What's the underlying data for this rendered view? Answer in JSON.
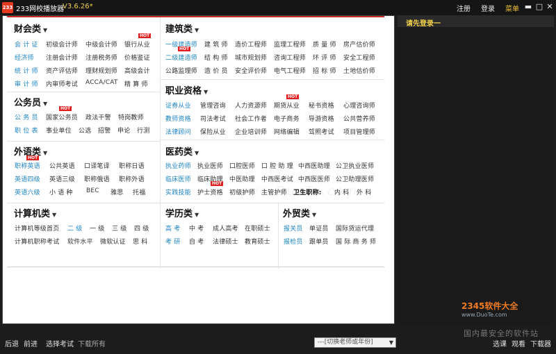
{
  "titlebar": {
    "logo": "233",
    "title": "233网校播放器",
    "version": "V3.6.26*",
    "register": "注册",
    "login": "登录",
    "menu": "菜单",
    "min": "▬",
    "max": "□",
    "close": "✕"
  },
  "sidebar": {
    "login_prompt": "请先登录一"
  },
  "sections": {
    "caikuai": {
      "title": "财会类",
      "rows": [
        [
          "会 计 证",
          "初级会计师",
          "中级会计师",
          "银行从业"
        ],
        [
          "经济师",
          "注册会计师",
          "注册税务师",
          "价格鉴证"
        ],
        [
          "统 计 师",
          "资产评估师",
          "理财规划师",
          "高级会计"
        ],
        [
          "审 计 师",
          "内审师考试",
          "ACCA/CAT",
          "精 算 师"
        ]
      ]
    },
    "jianzhu": {
      "title": "建筑类",
      "rows": [
        [
          "一级建造师",
          "建 筑 师",
          "造价工程师",
          "监理工程师",
          "质 量 师",
          "房产估价师"
        ],
        [
          "二级建造师",
          "结 构 师",
          "城市规划师",
          "咨询工程师",
          "环 评 师",
          "安全工程师"
        ],
        [
          "公路监理师",
          "造 价 员",
          "安全评价师",
          "电气工程师",
          "招 标 师",
          "土地估价师"
        ]
      ]
    },
    "gongwuyuan": {
      "title": "公务员",
      "rows": [
        [
          "公 务 员",
          "国家公务员",
          "政法干警",
          "特岗教师"
        ],
        [
          "职 位 表",
          "事业单位",
          "公选",
          "招警",
          "申论",
          "行测"
        ]
      ]
    },
    "zhiye": {
      "title": "职业资格",
      "rows": [
        [
          "证券从业",
          "管理咨询",
          "人力资源师",
          "期货从业",
          "秘书资格",
          "心理咨询师"
        ],
        [
          "教师资格",
          "司法考试",
          "社会工作者",
          "电子商务",
          "导游资格",
          "公共营养师"
        ],
        [
          "法律顾问",
          "保险从业",
          "企业培训师",
          "网络编辑",
          "驾照考试",
          "项目管理师"
        ]
      ]
    },
    "waiyu": {
      "title": "外语类",
      "rows": [
        [
          "职称英语",
          "公共英语",
          "口译笔译",
          "职称日语"
        ],
        [
          "英语四级",
          "英语三级",
          "职称俄语",
          "职称外语"
        ],
        [
          "英语六级",
          "小 语 种",
          "BEC",
          "雅思",
          "托福"
        ]
      ]
    },
    "yiyao": {
      "title": "医药类",
      "rows": [
        [
          "执业药师",
          "执业医师",
          "口腔医师",
          "口 腔 助 理",
          "中西医助理",
          "公卫执业医师"
        ],
        [
          "临床医师",
          "临床助理",
          "中医助理",
          "中西医考试",
          "中西医医师",
          "公卫助理医师"
        ],
        [
          "实践技能",
          "护士资格",
          "初级护师",
          "主管护师",
          "卫生职称:",
          "内 科",
          "外 科"
        ]
      ]
    },
    "jisuanji": {
      "title": "计算机类",
      "rows": [
        [
          "计算机等级首页",
          "二 级",
          "一 级",
          "三 级",
          "四 级"
        ],
        [
          "计算机职称考试",
          "软件水平",
          "微软认证",
          "思 科"
        ]
      ]
    },
    "xueli": {
      "title": "学历类",
      "rows": [
        [
          "高 考",
          "中 考",
          "成人高考",
          "在职硕士"
        ],
        [
          "考 研",
          "自 考",
          "法律硕士",
          "教育硕士"
        ]
      ]
    },
    "waimao": {
      "title": "外贸类",
      "rows": [
        [
          "报关员",
          "单证员",
          "国际货运代理"
        ],
        [
          "报检员",
          "跟单员",
          "国 际 商 务 师"
        ]
      ]
    }
  },
  "hot_label": "HOT",
  "watermark": "www.DuoTe.com",
  "bottom": {
    "back": "后退",
    "forward": "前进",
    "select_exam": "选择考试",
    "download_all": "下载所有",
    "teacher_select": "---[切换老师或年份]",
    "select_course": "选课",
    "watch": "观看",
    "downloader": "下载器"
  },
  "badge": {
    "brand": "2345软件大全",
    "url": "www.DuoTe.com",
    "slogan": "国内最安全的软件站"
  },
  "colors": {
    "accent_red": "#c9281e",
    "link_blue": "#1c84c6",
    "title_yellow": "#f2d24b",
    "hot_red": "#e01e1e"
  }
}
